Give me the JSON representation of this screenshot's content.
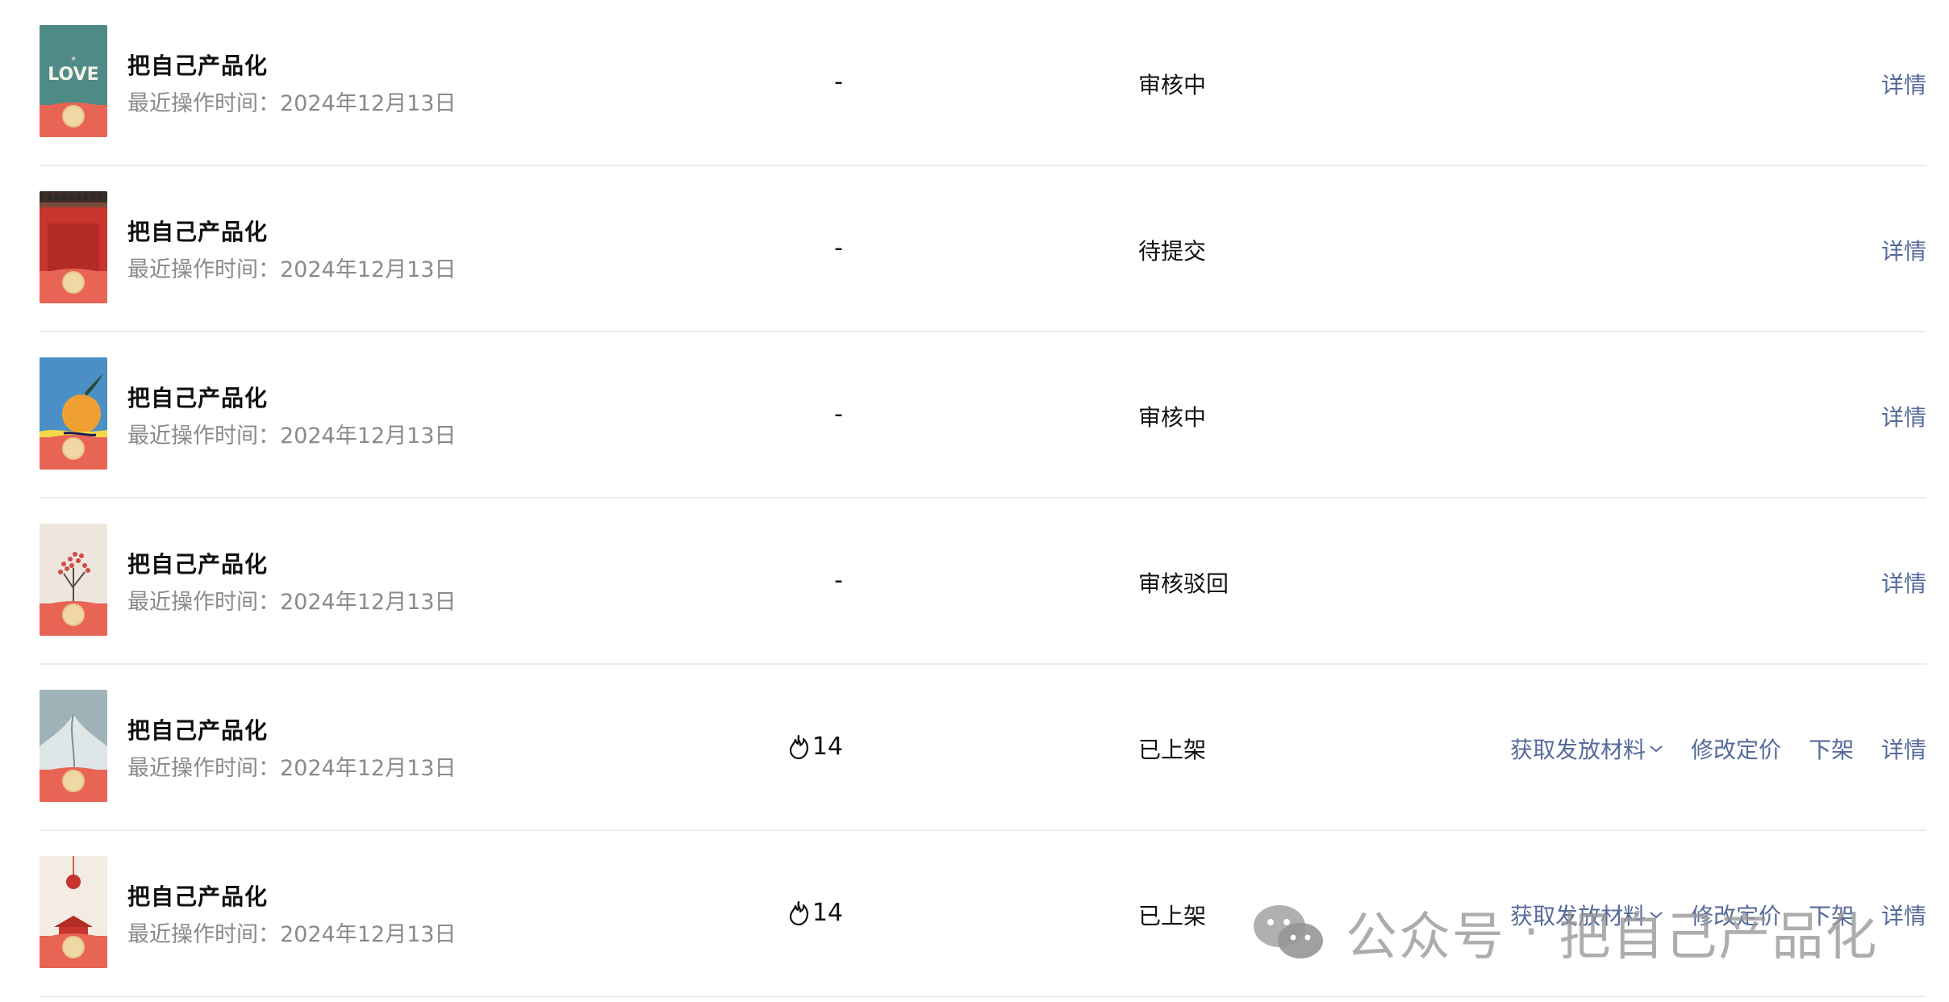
{
  "rows": [
    {
      "title": "把自己产品化",
      "subtitle": "最近操作时间：2024年12月13日",
      "count": "-",
      "status": "审核中",
      "cover": {
        "name": "love-cover",
        "text": "LOVE",
        "bg": "#4f8a86"
      },
      "actions": [
        "详情"
      ]
    },
    {
      "title": "把自己产品化",
      "subtitle": "最近操作时间：2024年12月13日",
      "count": "-",
      "status": "待提交",
      "cover": {
        "name": "red-gate-cover",
        "bg": "#c8342e"
      },
      "actions": [
        "详情"
      ]
    },
    {
      "title": "把自己产品化",
      "subtitle": "最近操作时间：2024年12月13日",
      "count": "-",
      "status": "审核中",
      "cover": {
        "name": "orange-fruit-cover",
        "bg": "#4a90c6"
      },
      "actions": [
        "详情"
      ]
    },
    {
      "title": "把自己产品化",
      "subtitle": "最近操作时间：2024年12月13日",
      "count": "-",
      "status": "审核驳回",
      "cover": {
        "name": "plum-tree-cover",
        "bg": "#ece6dc"
      },
      "actions": [
        "详情"
      ]
    },
    {
      "title": "把自己产品化",
      "subtitle": "最近操作时间：2024年12月13日",
      "count": "14",
      "status": "已上架",
      "cover": {
        "name": "whale-cover",
        "bg": "#9fb2b8"
      },
      "actions": [
        "获取发放材料",
        "修改定价",
        "下架",
        "详情"
      ]
    },
    {
      "title": "把自己产品化",
      "subtitle": "最近操作时间：2024年12月13日",
      "count": "14",
      "status": "已上架",
      "cover": {
        "name": "lantern-cover",
        "bg": "#f3ece2"
      },
      "actions": [
        "获取发放材料",
        "修改定价",
        "下架",
        "详情"
      ]
    }
  ],
  "watermark": {
    "left": "公众号",
    "separator": "·",
    "right": "把自己产品化"
  },
  "colors": {
    "link": "#566a9a",
    "cover_bottom": "#e86454",
    "divider": "#ececec"
  }
}
